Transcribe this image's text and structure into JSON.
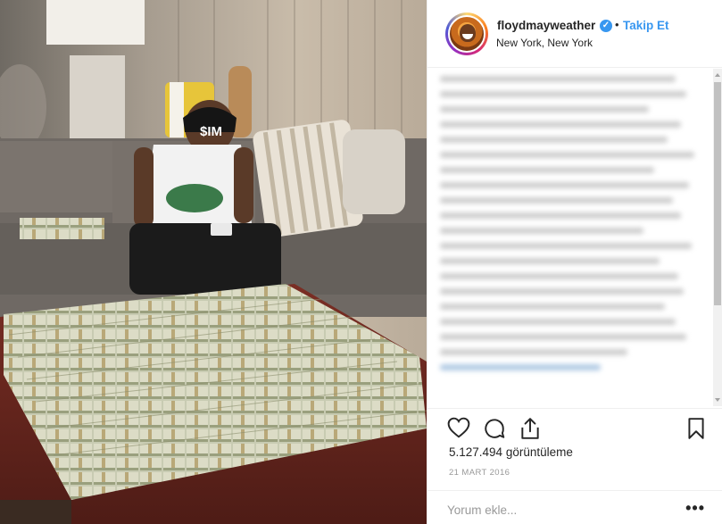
{
  "photo": {
    "description_icon": "photo-money-stacks",
    "cap_text": "$IM"
  },
  "header": {
    "username": "floydmayweather",
    "verified_icon": "verified-badge-icon",
    "separator": "•",
    "follow_label": "Takip Et",
    "location": "New York, New York"
  },
  "post": {
    "views_count": "5.127.494",
    "views_label": "görüntüleme",
    "date": "21 MART 2016"
  },
  "comment": {
    "placeholder": "Yorum ekle...",
    "more_label": "•••"
  },
  "colors": {
    "accent": "#3897f0",
    "border": "#efefef",
    "muted": "#999999"
  }
}
